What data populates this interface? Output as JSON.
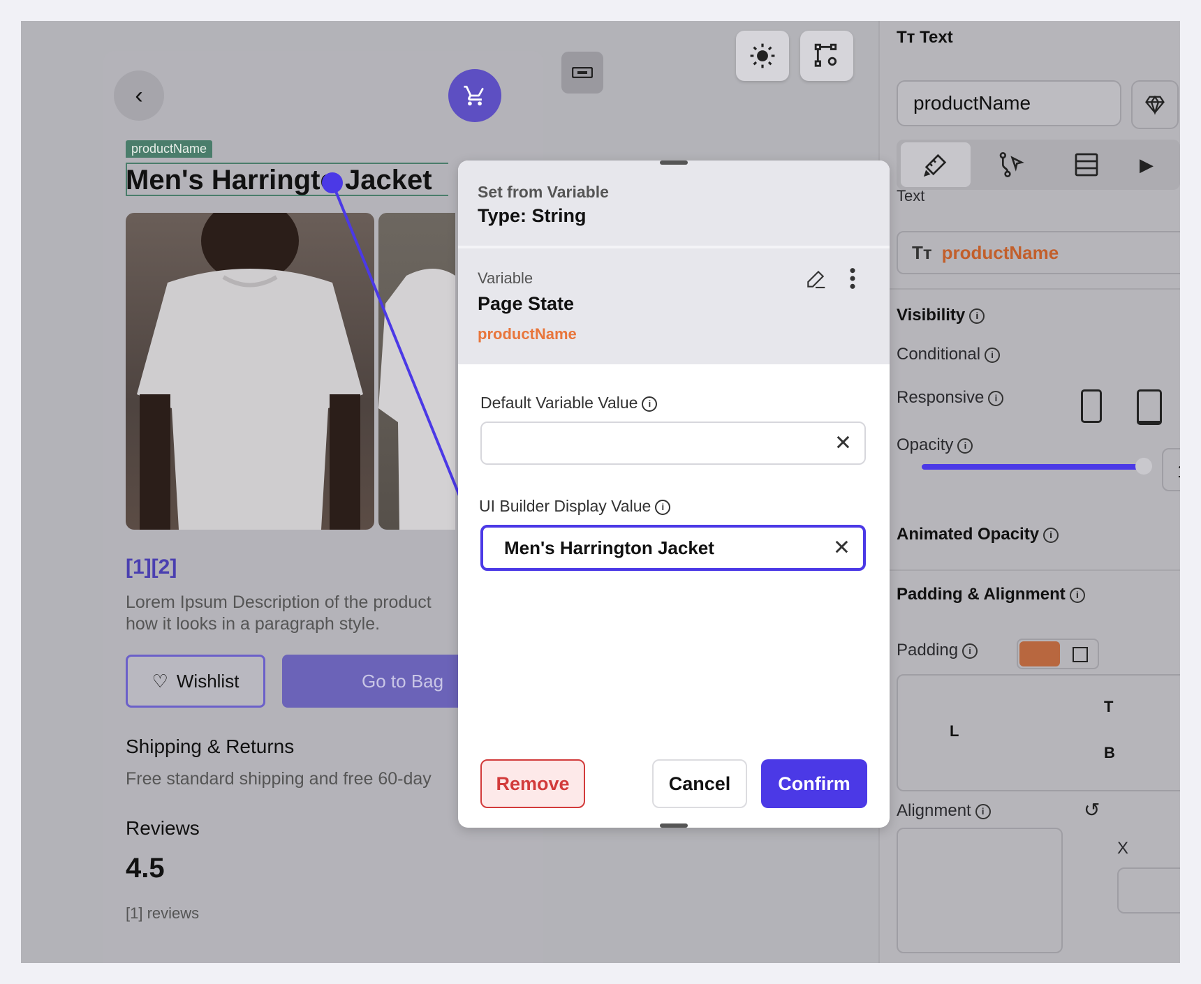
{
  "canvas": {
    "back_icon": "chevron-left-icon",
    "cart_icon": "cart-icon",
    "widget_tag": "productName",
    "product_title": "Men's Harringto  Jacket",
    "pager": "[1][2]",
    "description": "Lorem Ipsum Description of the product how it looks in a paragraph style.",
    "wishlist_label": "Wishlist",
    "bag_label": "Go to Bag",
    "shipping_title": "Shipping & Returns",
    "shipping_text": "Free standard shipping and free 60-day",
    "reviews_title": "Reviews",
    "rating": "4.5",
    "review_count": "[1] reviews"
  },
  "toolbar": {
    "theme_icon": "sun-icon",
    "settings_icon": "graph-settings-icon"
  },
  "right_panel": {
    "header": "Text",
    "name_value": "productName",
    "text_section_label": "Text",
    "text_value": "productName",
    "visibility": "Visibility",
    "conditional": "Conditional",
    "responsive": "Responsive",
    "opacity": "Opacity",
    "opacity_value": "1",
    "animated_opacity": "Animated Opacity",
    "padding_alignment": "Padding & Alignment",
    "padding": "Padding",
    "pad_top": "T",
    "pad_left": "L",
    "pad_bottom": "B",
    "alignment": "Alignment",
    "x_label": "X"
  },
  "modal": {
    "set_from": "Set from Variable",
    "type": "Type: String",
    "variable_label": "Variable",
    "variable_source": "Page State",
    "variable_name": "productName",
    "default_label": "Default Variable Value",
    "default_value": "",
    "display_label": "UI Builder Display Value",
    "display_value": "Men's Harrington Jacket",
    "remove": "Remove",
    "cancel": "Cancel",
    "confirm": "Confirm"
  },
  "colors": {
    "accent": "#4b39e6",
    "variable_orange": "#e8763c",
    "remove_red": "#d23b3b",
    "tag_green": "#4a7d6b"
  }
}
